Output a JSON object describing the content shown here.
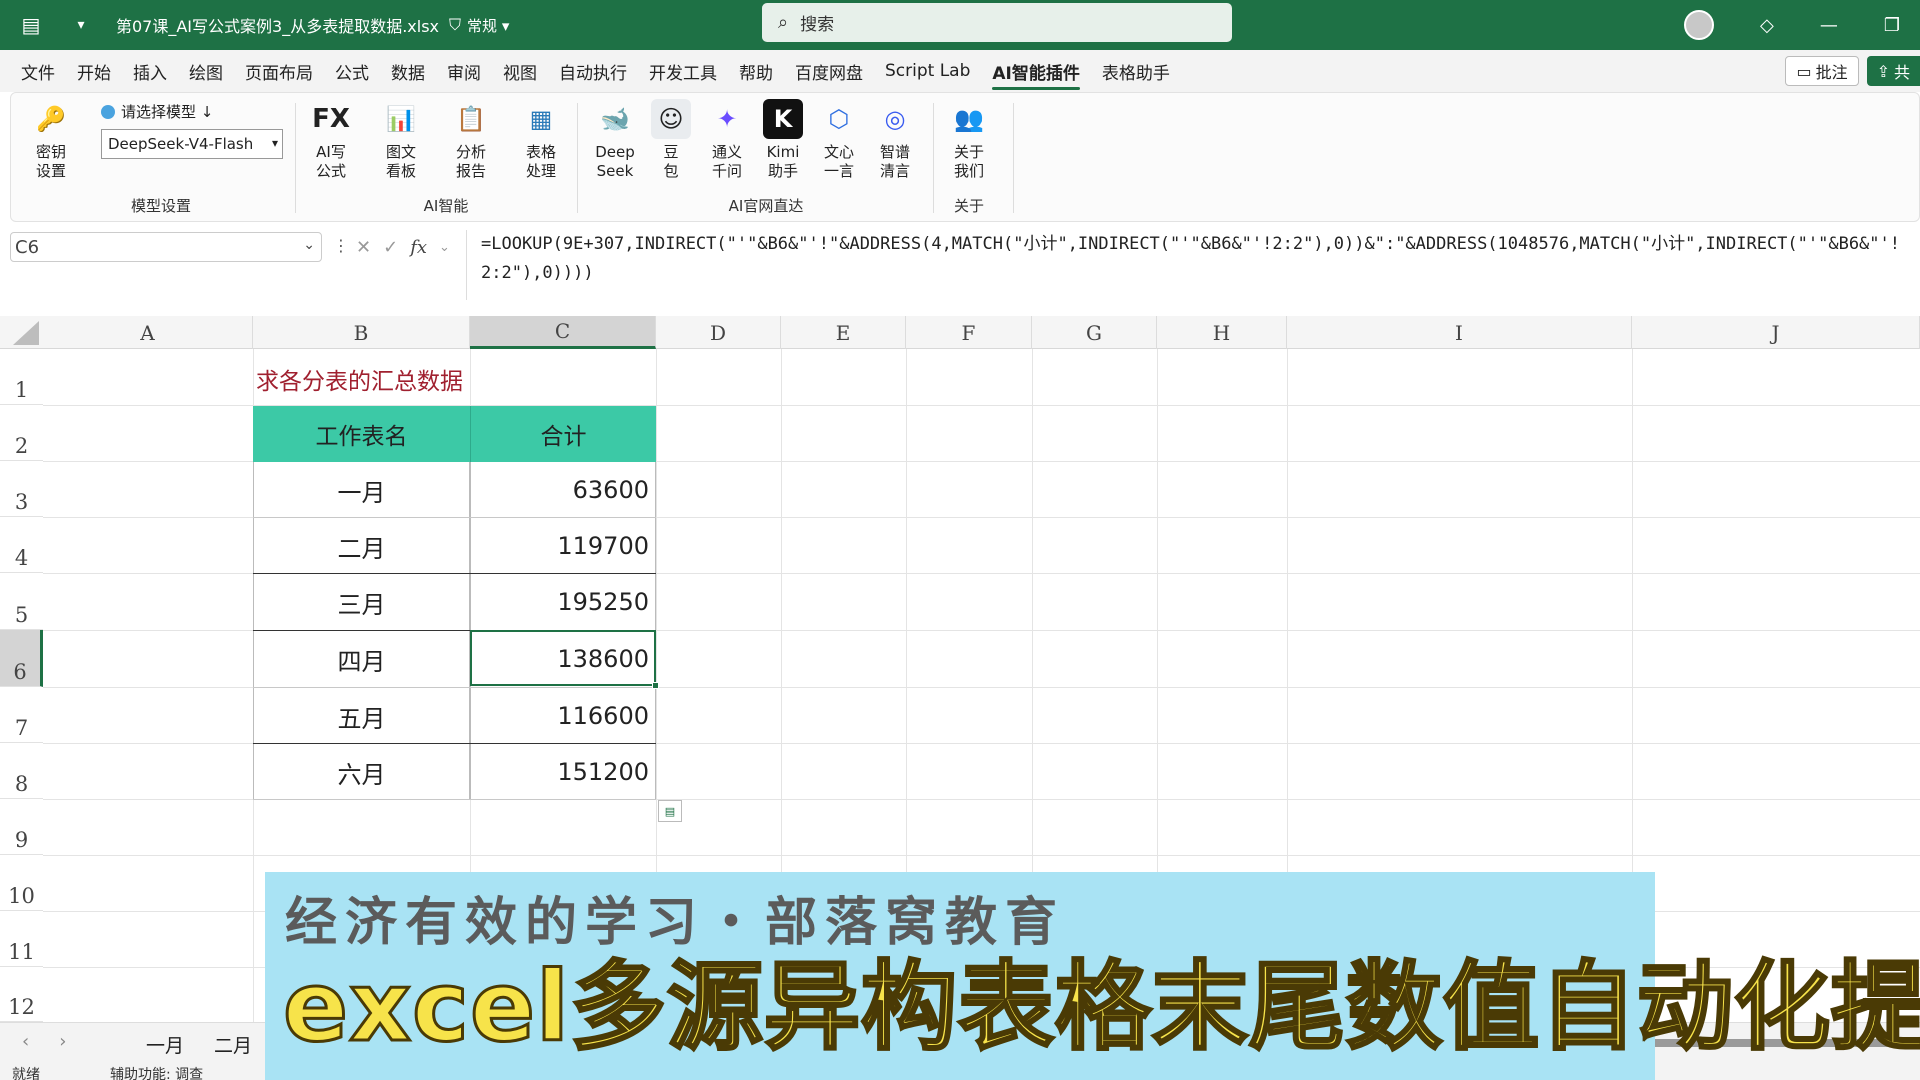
{
  "titlebar": {
    "filename": "第07课_AI写公式案例3_从多表提取数据.xlsx",
    "mode": "常规",
    "search_placeholder": "搜索"
  },
  "menu": {
    "tabs": [
      "文件",
      "开始",
      "插入",
      "绘图",
      "页面布局",
      "公式",
      "数据",
      "审阅",
      "视图",
      "自动执行",
      "开发工具",
      "帮助",
      "百度网盘",
      "Script Lab",
      "AI智能插件",
      "表格助手"
    ],
    "active_index": 14,
    "comment_label": "批注",
    "share_label": "共"
  },
  "ribbon": {
    "key_setting": "密钥\n设置",
    "model_label": "请选择模型 ↓",
    "model_value": "DeepSeek-V4-Flash",
    "group_model": "模型设置",
    "ai_buttons": [
      {
        "label": "AI写\n公式",
        "icon": "FX"
      },
      {
        "label": "图文\n看板",
        "icon": "📊"
      },
      {
        "label": "分析\n报告",
        "icon": "📋"
      },
      {
        "label": "表格\n处理",
        "icon": "▦"
      }
    ],
    "group_ai": "AI智能",
    "site_buttons": [
      {
        "label": "Deep\nSeek",
        "icon": "🐋",
        "color": "#4d6bfe"
      },
      {
        "label": "豆\n包",
        "icon": "☺",
        "color": "#e9ecef"
      },
      {
        "label": "通义\n千问",
        "icon": "✦",
        "color": "#6a4cff"
      },
      {
        "label": "Kimi\n助手",
        "icon": "K",
        "color": "#111111"
      },
      {
        "label": "文心\n一言",
        "icon": "⬡",
        "color": "#2f6fe0"
      },
      {
        "label": "智谱\n清言",
        "icon": "◎",
        "color": "#3a5cf0"
      }
    ],
    "group_sites": "AI官网直达",
    "about_button": "关于\n我们",
    "group_about": "关于"
  },
  "formula_bar": {
    "name_box": "C6",
    "formula": "=LOOKUP(9E+307,INDIRECT(\"'\"&B6&\"'!\"&ADDRESS(4,MATCH(\"小计\",INDIRECT(\"'\"&B6&\"'!2:2\"),0))&\":\"&ADDRESS(1048576,MATCH(\"小计\",INDIRECT(\"'\"&B6&\"'!2:2\"),0))))"
  },
  "grid": {
    "columns": [
      "A",
      "B",
      "C",
      "D",
      "E",
      "F",
      "G",
      "H",
      "I",
      "J"
    ],
    "selected_column": "C",
    "rows": [
      "1",
      "2",
      "3",
      "4",
      "5",
      "6",
      "7",
      "8",
      "9",
      "10",
      "11",
      "12"
    ],
    "selected_row": "6"
  },
  "sheet": {
    "title": "求各分表的汇总数据",
    "headers": [
      "工作表名",
      "合计"
    ],
    "rows": [
      {
        "name": "一月",
        "value": "63600"
      },
      {
        "name": "二月",
        "value": "119700"
      },
      {
        "name": "三月",
        "value": "195250"
      },
      {
        "name": "四月",
        "value": "138600"
      },
      {
        "name": "五月",
        "value": "116600"
      },
      {
        "name": "六月",
        "value": "151200"
      }
    ]
  },
  "sheet_tabs": [
    "一月",
    "二月"
  ],
  "status": {
    "ready": "就绪",
    "accessibility": "辅助功能: 调查"
  },
  "banner": {
    "subtitle": "经济有效的学习・部落窝教育",
    "headline": "excel多源异构表格末尾数值自动化提取"
  },
  "colors": {
    "excel_green": "#1e7145",
    "header_fill": "#3cc9a6",
    "title_red": "#a0202f",
    "banner_bg": "#a9e3f4",
    "banner_text": "#f7e34a"
  }
}
